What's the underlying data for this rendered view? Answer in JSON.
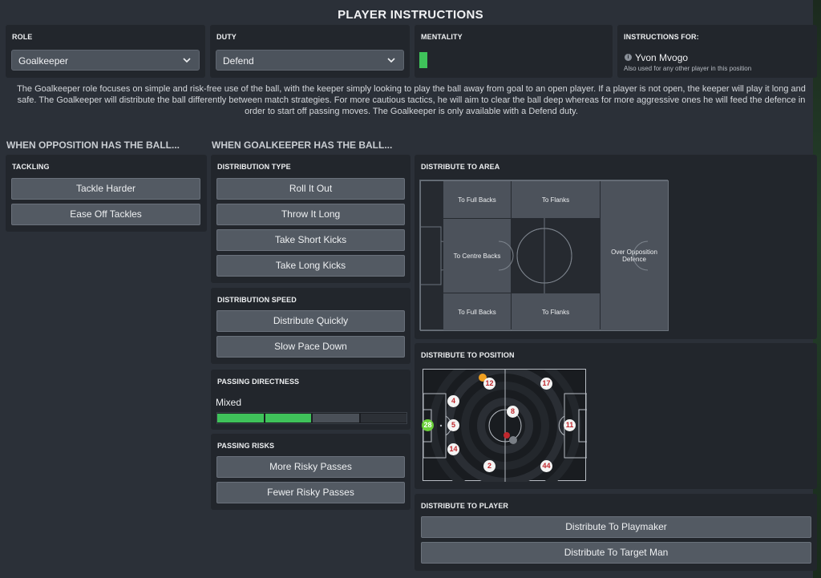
{
  "title": "PLAYER INSTRUCTIONS",
  "role": {
    "label": "ROLE",
    "value": "Goalkeeper"
  },
  "duty": {
    "label": "DUTY",
    "value": "Defend"
  },
  "mentality": {
    "label": "MENTALITY",
    "bar_color": "#3fc25a"
  },
  "instructions_for": {
    "label": "INSTRUCTIONS FOR:",
    "player": "Yvon Mvogo",
    "note": "Also used for any other player in this position"
  },
  "description": "The Goalkeeper role focuses on simple and risk-free use of the ball, with the keeper simply looking to play the ball away from goal to an open player. If a player is not open, the keeper will play it long and safe. The Goalkeeper will distribute the ball differently between match strategies. For more cautious tactics, he will aim to clear the ball deep whereas for more aggressive ones he will feed the defence in order to start off passing moves. The Goalkeeper is only available with a Defend duty.",
  "sections": {
    "opposition": "WHEN OPPOSITION HAS THE BALL...",
    "goalkeeper": "WHEN GOALKEEPER HAS THE BALL..."
  },
  "tackling": {
    "label": "TACKLING",
    "buttons": [
      "Tackle Harder",
      "Ease Off Tackles"
    ]
  },
  "distribution_type": {
    "label": "DISTRIBUTION TYPE",
    "buttons": [
      "Roll It Out",
      "Throw It Long",
      "Take Short Kicks",
      "Take Long Kicks"
    ]
  },
  "distribution_speed": {
    "label": "DISTRIBUTION SPEED",
    "buttons": [
      "Distribute Quickly",
      "Slow Pace Down"
    ]
  },
  "passing_directness": {
    "label": "PASSING DIRECTNESS",
    "value": "Mixed",
    "level": 0.5
  },
  "passing_risks": {
    "label": "PASSING RISKS",
    "buttons": [
      "More Risky Passes",
      "Fewer Risky Passes"
    ]
  },
  "distribute_to_area": {
    "label": "DISTRIBUTE TO AREA",
    "zones": {
      "full_backs_top": "To Full Backs",
      "flanks_top": "To Flanks",
      "centre_backs": "To Centre Backs",
      "over_defence": "Over Opposition Defence",
      "full_backs_bottom": "To Full Backs",
      "flanks_bottom": "To Flanks"
    }
  },
  "distribute_to_position": {
    "label": "DISTRIBUTE TO POSITION",
    "keeper_number": "28",
    "players": [
      "12",
      "17",
      "4",
      "8",
      "11",
      "5",
      "14",
      "2",
      "44"
    ]
  },
  "distribute_to_player": {
    "label": "DISTRIBUTE TO PLAYER",
    "buttons": [
      "Distribute To Playmaker",
      "Distribute To Target Man"
    ]
  },
  "colors": {
    "accent_green": "#3fc25a",
    "player_red": "#c0282e",
    "ball_orange": "#f0a020"
  }
}
